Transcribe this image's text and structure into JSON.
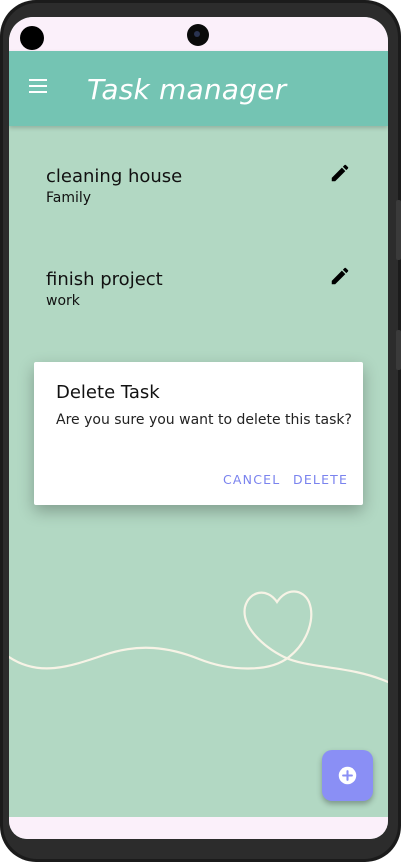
{
  "app_bar": {
    "title": "Task manager",
    "menu_icon": "menu-icon",
    "color": "#74c4b3"
  },
  "tasks": [
    {
      "title": "cleaning house",
      "category": "Family",
      "action_icon": "edit-icon"
    },
    {
      "title": "finish project",
      "category": "work",
      "action_icon": "edit-icon"
    }
  ],
  "dialog": {
    "title": "Delete Task",
    "message": "Are you sure you want to delete this task?",
    "cancel_label": "CANCEL",
    "delete_label": "DELETE",
    "button_color": "#7a83ee"
  },
  "fab": {
    "icon": "add-circle-icon",
    "color": "#8a8ff5"
  },
  "colors": {
    "background": "#b2d8c3",
    "status_bar": "#fbf0fa"
  }
}
